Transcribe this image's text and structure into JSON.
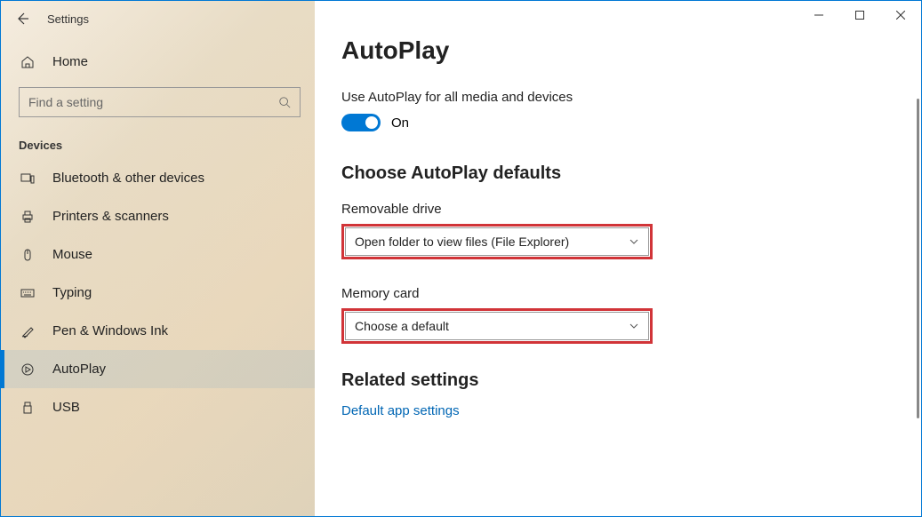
{
  "window": {
    "title": "Settings"
  },
  "sidebar": {
    "home_label": "Home",
    "search_placeholder": "Find a setting",
    "section_label": "Devices",
    "items": [
      {
        "label": "Bluetooth & other devices"
      },
      {
        "label": "Printers & scanners"
      },
      {
        "label": "Mouse"
      },
      {
        "label": "Typing"
      },
      {
        "label": "Pen & Windows Ink"
      },
      {
        "label": "AutoPlay"
      },
      {
        "label": "USB"
      }
    ]
  },
  "main": {
    "title": "AutoPlay",
    "toggle_description": "Use AutoPlay for all media and devices",
    "toggle_state_label": "On",
    "defaults_heading": "Choose AutoPlay defaults",
    "removable_label": "Removable drive",
    "removable_value": "Open folder to view files (File Explorer)",
    "memory_label": "Memory card",
    "memory_value": "Choose a default",
    "related_heading": "Related settings",
    "related_link": "Default app settings"
  }
}
